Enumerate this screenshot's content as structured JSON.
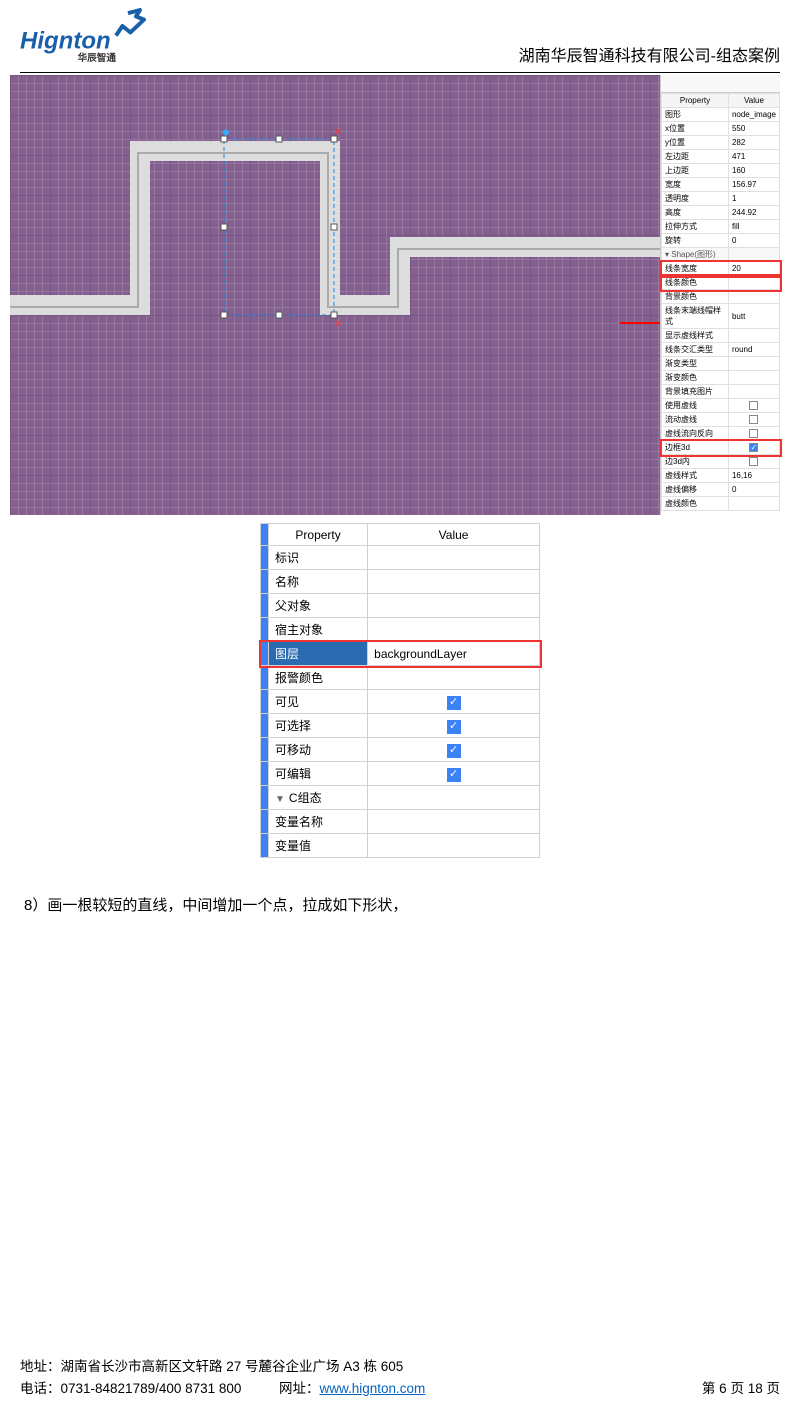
{
  "header": {
    "company_title": "湖南华辰智通科技有限公司-组态案例",
    "logo_text": "Hignton",
    "logo_sub": "华辰智通"
  },
  "panel1": {
    "header_property": "Property",
    "header_value": "Value",
    "rows": [
      {
        "k": "图形",
        "v": "node_image"
      },
      {
        "k": "x位置",
        "v": "550"
      },
      {
        "k": "y位置",
        "v": "282"
      },
      {
        "k": "左边距",
        "v": "471"
      },
      {
        "k": "上边距",
        "v": "160"
      },
      {
        "k": "宽度",
        "v": "156.97"
      },
      {
        "k": "透明度",
        "v": "1"
      },
      {
        "k": "高度",
        "v": "244.92"
      },
      {
        "k": "拉伸方式",
        "v": "fill"
      },
      {
        "k": "旋转",
        "v": "0"
      },
      {
        "k": "Shape(图形)",
        "v": "",
        "section": true
      },
      {
        "k": "线条宽度",
        "v": "20",
        "hl": true
      },
      {
        "k": "线条颜色",
        "v": "",
        "hl": true
      },
      {
        "k": "背景颜色",
        "v": ""
      },
      {
        "k": "线条末端线帽样式",
        "v": "butt"
      },
      {
        "k": "显示虚线样式",
        "v": ""
      },
      {
        "k": "线条交汇类型",
        "v": "round"
      },
      {
        "k": "渐变类型",
        "v": ""
      },
      {
        "k": "渐变颜色",
        "v": ""
      },
      {
        "k": "背景填充图片",
        "v": ""
      },
      {
        "k": "使用虚线",
        "v": "",
        "check": false
      },
      {
        "k": "流动虚线",
        "v": "",
        "check": false
      },
      {
        "k": "虚线流向反向",
        "v": "",
        "check": false
      },
      {
        "k": "边框3d",
        "v": "",
        "check": true,
        "hl": true
      },
      {
        "k": "边3d内",
        "v": "",
        "check": false
      },
      {
        "k": "虚线样式",
        "v": "16,16"
      },
      {
        "k": "虚线偏移",
        "v": "0"
      },
      {
        "k": "虚线颜色",
        "v": ""
      }
    ]
  },
  "panel2": {
    "header_property": "Property",
    "header_value": "Value",
    "rows": [
      {
        "k": "标识",
        "v": ""
      },
      {
        "k": "名称",
        "v": ""
      },
      {
        "k": "父对象",
        "v": ""
      },
      {
        "k": "宿主对象",
        "v": ""
      },
      {
        "k": "图层",
        "v": "backgroundLayer",
        "highlight": true
      },
      {
        "k": "报警颜色",
        "v": ""
      },
      {
        "k": "可见",
        "v": "",
        "check": true
      },
      {
        "k": "可选择",
        "v": "",
        "check": true
      },
      {
        "k": "可移动",
        "v": "",
        "check": true
      },
      {
        "k": "可编辑",
        "v": "",
        "check": true
      },
      {
        "k": "C组态",
        "v": "",
        "section": true
      },
      {
        "k": "变量名称",
        "v": ""
      },
      {
        "k": "变量值",
        "v": ""
      }
    ]
  },
  "body_text": "8）画一根较短的直线，中间增加一个点，拉成如下形状，",
  "footer": {
    "address_label": "地址：",
    "address": "湖南省长沙市高新区文轩路 27 号麓谷企业广场 A3 栋 605",
    "phone_label": "电话：",
    "phone": "0731-84821789/400 8731 800",
    "url_label": "网址：",
    "url": "www.hignton.com",
    "page_current": "6",
    "page_total": "18",
    "page_prefix": "第",
    "page_mid": "页",
    "page_suffix": "页"
  }
}
